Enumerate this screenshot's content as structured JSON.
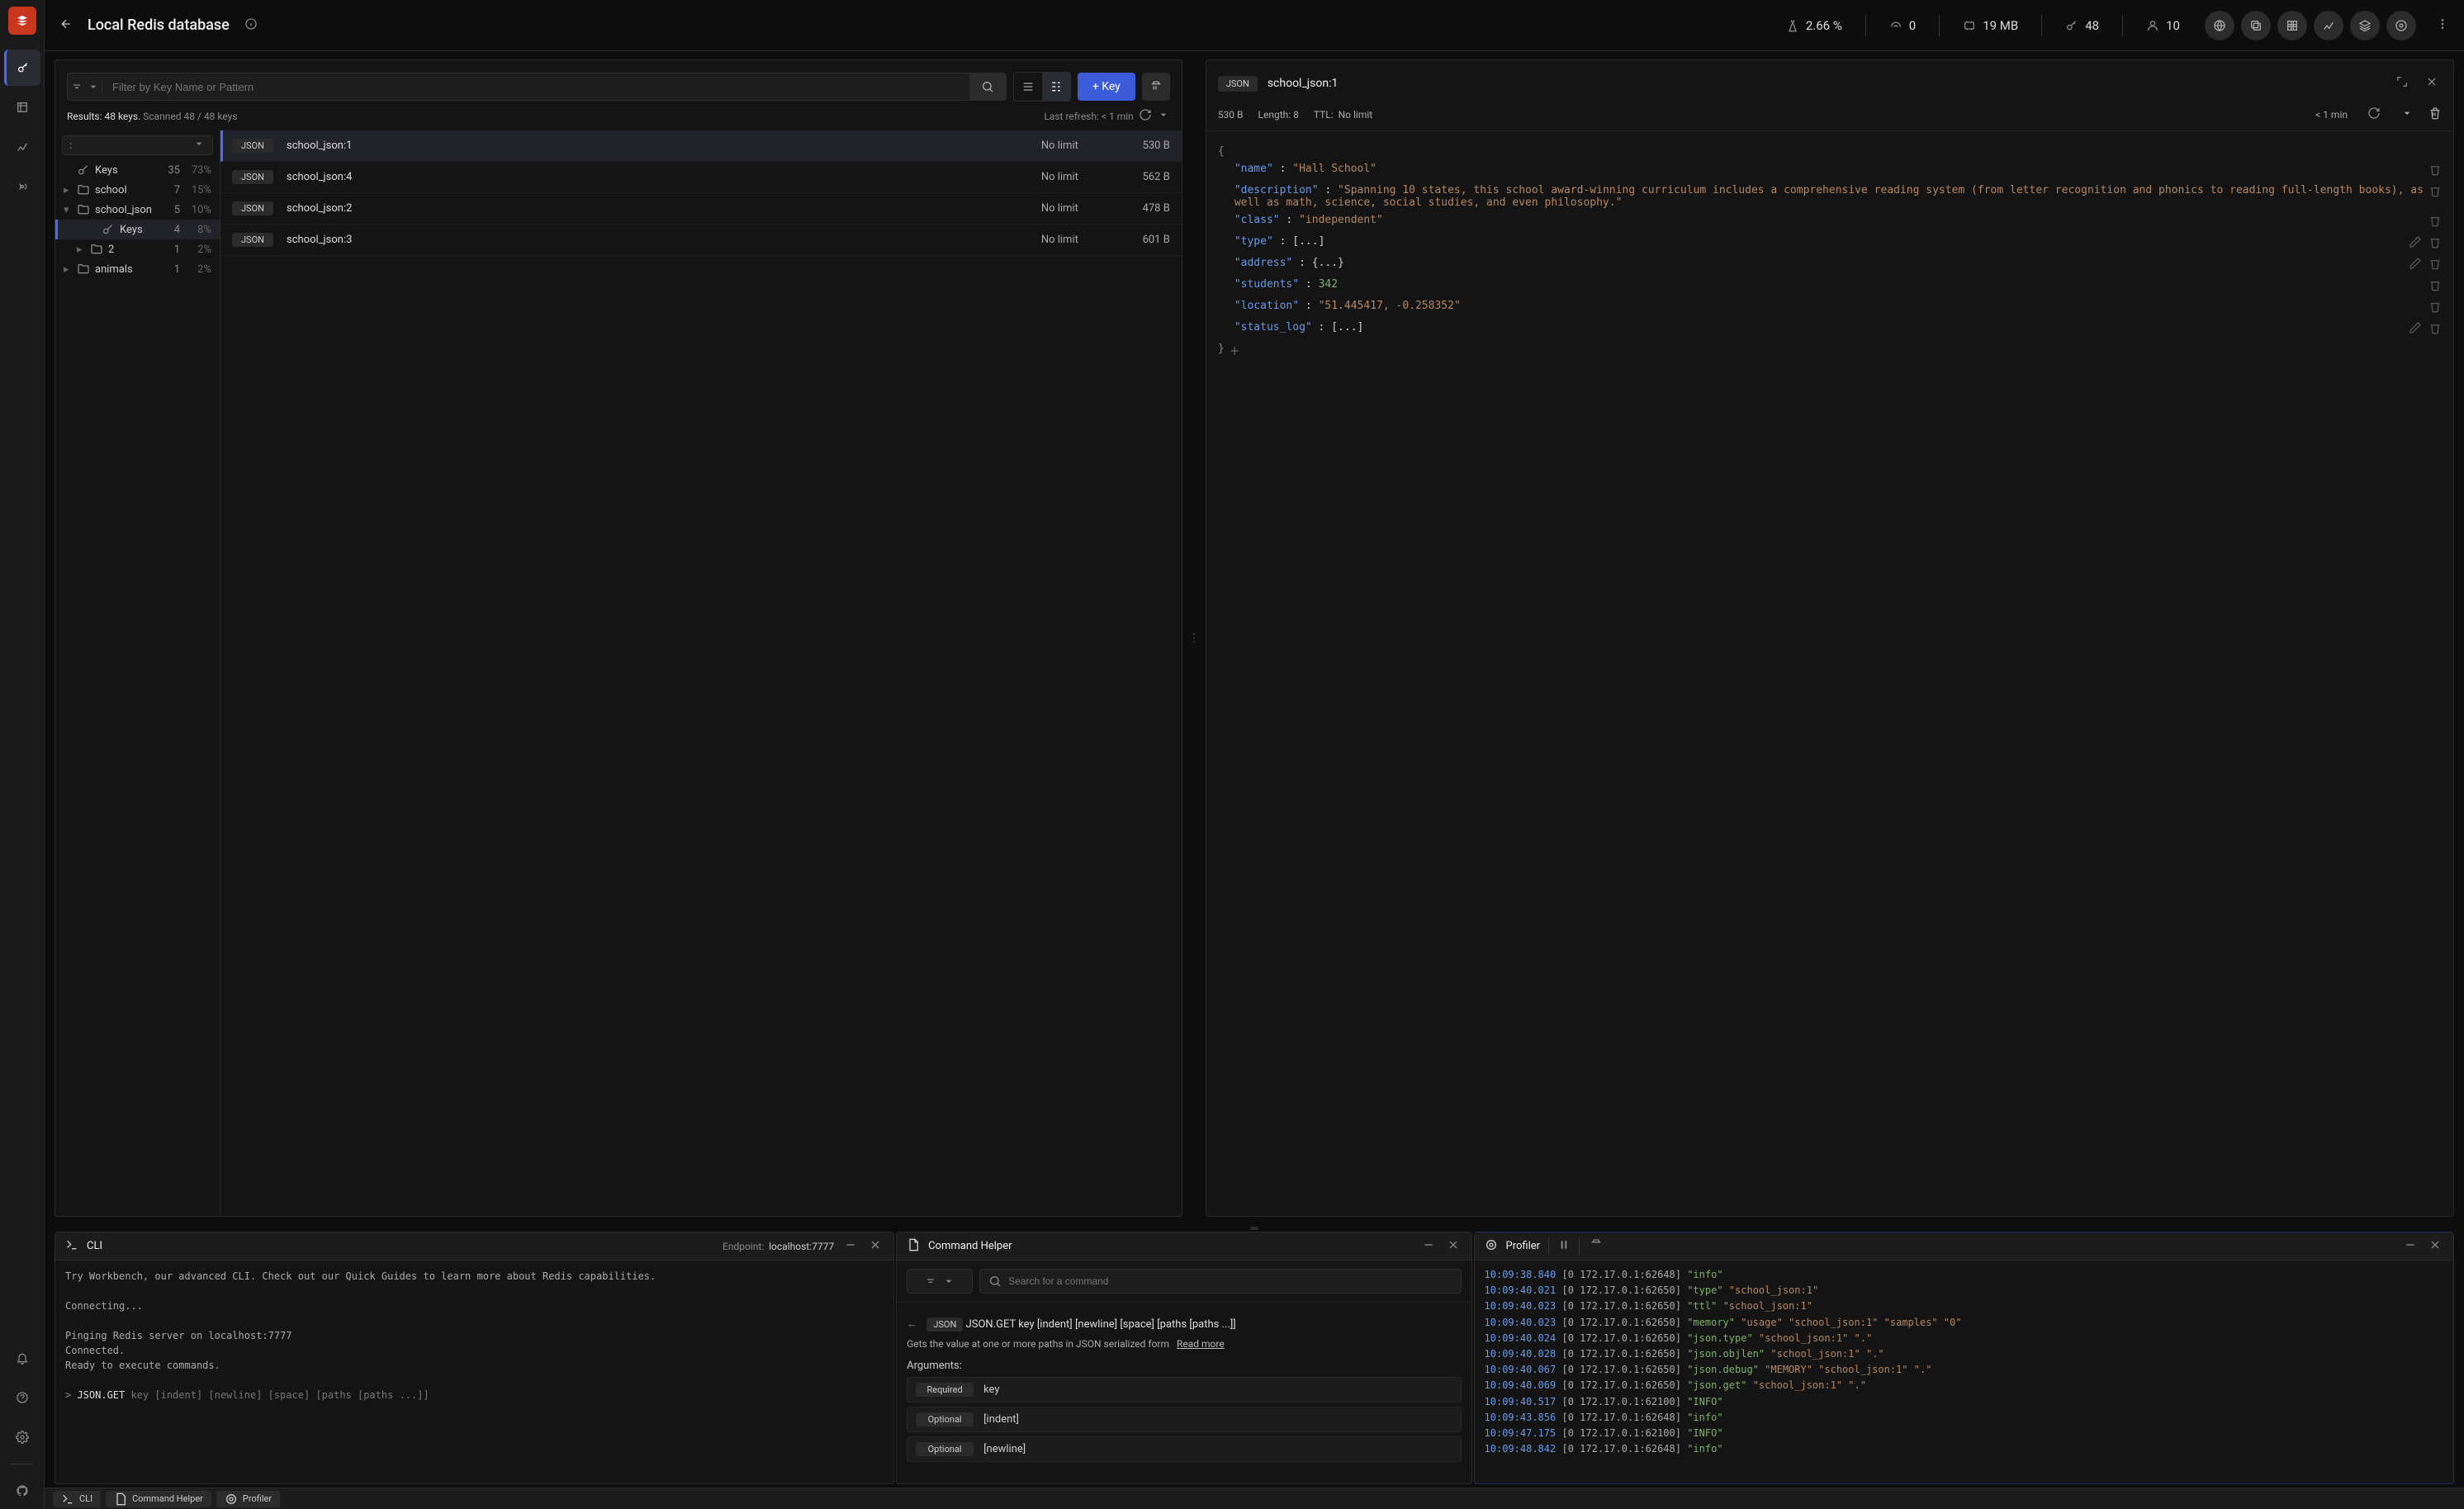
{
  "header": {
    "title": "Local Redis database",
    "stats": {
      "cpu": "2.66 %",
      "commands": "0",
      "memory": "19 MB",
      "keys": "48",
      "clients": "10"
    }
  },
  "browser": {
    "filter_placeholder": "Filter by Key Name or Pattern",
    "add_key_label": "+ Key",
    "results_prefix": "Results:",
    "results_count": "48 keys.",
    "scanned": "Scanned 48 / 48 keys",
    "last_refresh": "Last refresh: < 1 min",
    "tree_filter": ":",
    "tree": [
      {
        "icon": "key",
        "label": "Keys",
        "count": "35",
        "pct": "73%",
        "indent": 0
      },
      {
        "icon": "folder",
        "label": "school",
        "count": "7",
        "pct": "15%",
        "indent": 0,
        "chev": "right"
      },
      {
        "icon": "folder",
        "label": "school_json",
        "count": "5",
        "pct": "10%",
        "indent": 0,
        "chev": "down"
      },
      {
        "icon": "key",
        "label": "Keys",
        "count": "4",
        "pct": "8%",
        "indent": 1,
        "active": true
      },
      {
        "icon": "folder",
        "label": "2",
        "count": "1",
        "pct": "2%",
        "indent": 1,
        "chev": "right"
      },
      {
        "icon": "folder",
        "label": "animals",
        "count": "1",
        "pct": "2%",
        "indent": 0,
        "chev": "right"
      }
    ],
    "rows": [
      {
        "type": "JSON",
        "name": "school_json:1",
        "ttl": "No limit",
        "size": "530 B",
        "selected": true
      },
      {
        "type": "JSON",
        "name": "school_json:4",
        "ttl": "No limit",
        "size": "562 B"
      },
      {
        "type": "JSON",
        "name": "school_json:2",
        "ttl": "No limit",
        "size": "478 B"
      },
      {
        "type": "JSON",
        "name": "school_json:3",
        "ttl": "No limit",
        "size": "601 B"
      }
    ]
  },
  "detail": {
    "badge": "JSON",
    "key_name": "school_json:1",
    "key_size": "530 B",
    "length_label": "Length:",
    "length": "8",
    "ttl_label": "TTL:",
    "ttl": "No limit",
    "last_refresh": "< 1 min",
    "json_lines": [
      {
        "open": "{"
      },
      {
        "k": "\"name\"",
        "sep": " : ",
        "v": "\"Hall School\"",
        "vtype": "str"
      },
      {
        "k": "\"description\"",
        "sep": " : ",
        "v": "\"Spanning 10 states, this school award-winning curriculum includes a comprehensive reading system (from letter recognition and phonics to reading full-length books), as well as math, science, social studies, and even philosophy.\"",
        "vtype": "str"
      },
      {
        "k": "\"class\"",
        "sep": " : ",
        "v": "\"independent\"",
        "vtype": "str"
      },
      {
        "k": "\"type\"",
        "sep": " : ",
        "v": "[...]",
        "vtype": "col",
        "edit": true
      },
      {
        "k": "\"address\"",
        "sep": " : ",
        "v": "{...}",
        "vtype": "col",
        "edit": true
      },
      {
        "k": "\"students\"",
        "sep": " : ",
        "v": "342",
        "vtype": "num"
      },
      {
        "k": "\"location\"",
        "sep": " : ",
        "v": "\"51.445417, -0.258352\"",
        "vtype": "str"
      },
      {
        "k": "\"status_log\"",
        "sep": " : ",
        "v": "[...]",
        "vtype": "col",
        "edit": true
      },
      {
        "close": "}",
        "add": true
      }
    ]
  },
  "cli": {
    "title": "CLI",
    "endpoint_label": "Endpoint:",
    "endpoint": "localhost:7777",
    "lines": [
      {
        "text": "Try Workbench, our advanced CLI. Check out our Quick Guides to learn more about Redis capabilities.",
        "hint": true
      },
      {
        "text": ""
      },
      {
        "text": "Connecting..."
      },
      {
        "text": ""
      },
      {
        "text": "Pinging Redis server on localhost:7777"
      },
      {
        "text": "Connected."
      },
      {
        "text": "Ready to execute commands."
      },
      {
        "text": ""
      }
    ],
    "prompt_cmd": "JSON.GET",
    "prompt_args": "key [indent] [newline] [space] [paths [paths ...]]"
  },
  "helper": {
    "title": "Command Helper",
    "search_placeholder": "Search for a command",
    "cmd_badge": "JSON",
    "cmd_name": "JSON.GET key [indent] [newline] [space] [paths [paths ...]]",
    "desc": "Gets the value at one or more paths in JSON serialized form",
    "read_more": "Read more",
    "args_title": "Arguments:",
    "args": [
      {
        "tag": "Required",
        "name": "key"
      },
      {
        "tag": "Optional",
        "name": "[indent]"
      },
      {
        "tag": "Optional",
        "name": "[newline]"
      }
    ]
  },
  "profiler": {
    "title": "Profiler",
    "rows": [
      {
        "ts": "10:09:38.840",
        "addr": "[0 172.17.0.1:62648]",
        "cmd": "\"info\"",
        "arg": ""
      },
      {
        "ts": "10:09:40.021",
        "addr": "[0 172.17.0.1:62650]",
        "cmd": "\"type\"",
        "arg": "\"school_json:1\""
      },
      {
        "ts": "10:09:40.023",
        "addr": "[0 172.17.0.1:62650]",
        "cmd": "\"ttl\"",
        "arg": "\"school_json:1\""
      },
      {
        "ts": "10:09:40.023",
        "addr": "[0 172.17.0.1:62650]",
        "cmd": "\"memory\"",
        "arg": "\"usage\" \"school_json:1\" \"samples\" \"0\""
      },
      {
        "ts": "10:09:40.024",
        "addr": "[0 172.17.0.1:62650]",
        "cmd": "\"json.type\"",
        "arg": "\"school_json:1\" \".\""
      },
      {
        "ts": "10:09:40.028",
        "addr": "[0 172.17.0.1:62650]",
        "cmd": "\"json.objlen\"",
        "arg": "\"school_json:1\" \".\""
      },
      {
        "ts": "10:09:40.067",
        "addr": "[0 172.17.0.1:62650]",
        "cmd": "\"json.debug\"",
        "arg": "\"MEMORY\" \"school_json:1\" \".\""
      },
      {
        "ts": "10:09:40.069",
        "addr": "[0 172.17.0.1:62650]",
        "cmd": "\"json.get\"",
        "arg": "\"school_json:1\" \".\""
      },
      {
        "ts": "10:09:40.517",
        "addr": "[0 172.17.0.1:62100]",
        "cmd": "\"INFO\"",
        "arg": ""
      },
      {
        "ts": "10:09:43.856",
        "addr": "[0 172.17.0.1:62648]",
        "cmd": "\"info\"",
        "arg": ""
      },
      {
        "ts": "10:09:47.175",
        "addr": "[0 172.17.0.1:62100]",
        "cmd": "\"INFO\"",
        "arg": ""
      },
      {
        "ts": "10:09:48.842",
        "addr": "[0 172.17.0.1:62648]",
        "cmd": "\"info\"",
        "arg": ""
      }
    ]
  },
  "bottombar": {
    "cli": "CLI",
    "helper": "Command Helper",
    "profiler": "Profiler"
  }
}
